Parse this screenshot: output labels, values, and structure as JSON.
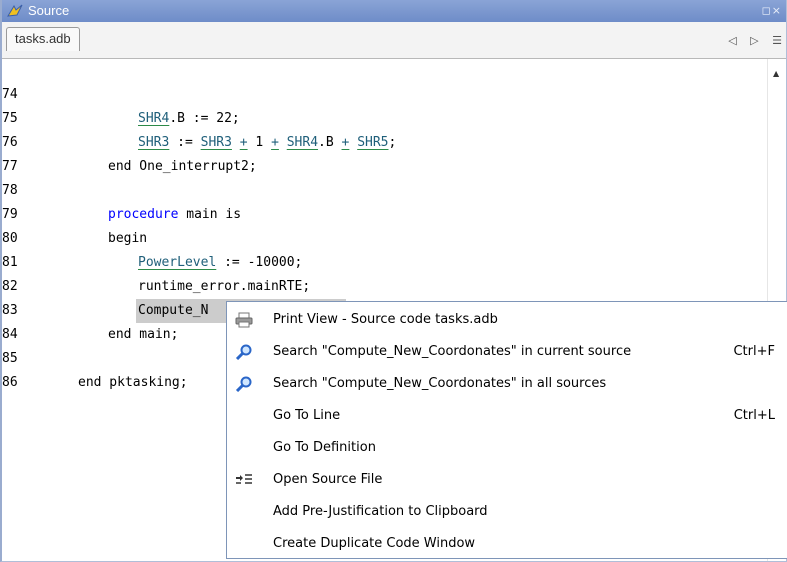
{
  "window": {
    "title": "Source",
    "title_buttons": "◻×"
  },
  "tabs": [
    {
      "label": "tasks.adb"
    }
  ],
  "tab_nav": {
    "prev": "◁",
    "next": "▷",
    "list": "☰"
  },
  "editor": {
    "lines": [
      {
        "num": "74"
      },
      {
        "num": "75"
      },
      {
        "num": "76"
      },
      {
        "num": "77"
      },
      {
        "num": "78"
      },
      {
        "num": "79"
      },
      {
        "num": "80"
      },
      {
        "num": "81"
      },
      {
        "num": "82"
      },
      {
        "num": "83"
      },
      {
        "num": "84"
      },
      {
        "num": "85"
      },
      {
        "num": "86"
      }
    ],
    "code": {
      "l74_a": "SHR4",
      "l74_b": ".B := 22;",
      "l75_a": "SHR3",
      "l75_b": " := ",
      "l75_c": "SHR3",
      "l75_d": " ",
      "l75_e": "+",
      "l75_f": " 1 ",
      "l75_g": "+",
      "l75_h": " ",
      "l75_i": "SHR4",
      "l75_j": ".B ",
      "l75_k": "+",
      "l75_l": " ",
      "l75_m": "SHR5",
      "l75_n": ";",
      "l76": "end One_interrupt2;",
      "l78_kw": "procedure",
      "l78_rest": " main is",
      "l79": "begin",
      "l80_a": "PowerLevel",
      "l80_b": " := -10000;",
      "l81": "runtime_error.mainRTE;",
      "l82": "Compute_N",
      "l83": "end main;",
      "l85": "end pktasking;"
    }
  },
  "context_menu": {
    "items": [
      {
        "label": "Print View - Source code tasks.adb",
        "shortcut": "",
        "icon": "printer-icon"
      },
      {
        "label": "Search \"Compute_New_Coordonates\" in current source",
        "shortcut": "Ctrl+F",
        "icon": "search-icon"
      },
      {
        "label": "Search \"Compute_New_Coordonates\" in all sources",
        "shortcut": "",
        "icon": "search-icon"
      },
      {
        "label": "Go To Line",
        "shortcut": "Ctrl+L",
        "icon": ""
      },
      {
        "label": "Go To Definition",
        "shortcut": "",
        "icon": ""
      },
      {
        "label": "Open Source File",
        "shortcut": "",
        "icon": "open-source-icon"
      },
      {
        "label": "Add Pre-Justification to Clipboard",
        "shortcut": "",
        "icon": ""
      },
      {
        "label": "Create Duplicate Code Window",
        "shortcut": "",
        "icon": ""
      }
    ]
  },
  "colors": {
    "keyword": "#0000ff",
    "reference": "#1f5f7a",
    "underline": "#2c8a48",
    "titlebar": "#7893cc"
  }
}
